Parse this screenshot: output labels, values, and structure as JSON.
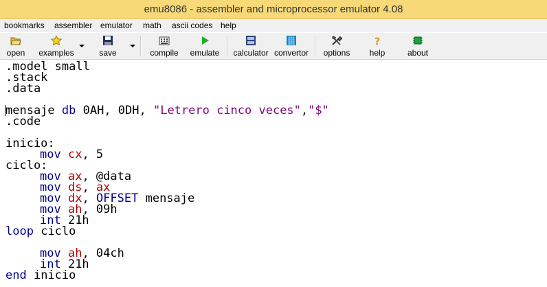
{
  "window": {
    "title": "emu8086 - assembler and microprocessor emulator 4.08"
  },
  "menu": {
    "items": [
      "bookmarks",
      "assembler",
      "emulator",
      "math",
      "ascii codes",
      "help"
    ]
  },
  "toolbar": {
    "open": "open",
    "examples": "examples",
    "save": "save",
    "compile": "compile",
    "emulate": "emulate",
    "calculator": "calculator",
    "convertor": "convertor",
    "options": "options",
    "help": "help",
    "about": "about"
  },
  "icons": {
    "open": "folder-open-icon",
    "examples": "star-icon",
    "save": "floppy-disk-icon",
    "compile": "compile-icon",
    "emulate": "play-icon",
    "calculator": "calculator-icon",
    "convertor": "convertor-icon",
    "options": "tools-icon",
    "help": "question-mark-icon",
    "about": "chip-icon"
  },
  "colors": {
    "titlebar": "#f8d978",
    "keyword": "#00008b",
    "register": "#b00000",
    "string": "#800080"
  },
  "code": {
    "l1": ".model small",
    "l2": ".stack",
    "l3": ".data",
    "l5_a": "mensaje ",
    "l5_b": "db",
    "l5_c": " 0AH, 0DH, ",
    "l5_d": "\"Letrero cinco veces\"",
    "l5_e": ",",
    "l5_f": "\"$\"",
    "l6": ".code",
    "l8": "inicio:",
    "l9_a": "mov",
    "l9_b": "cx",
    "l9_c": ", 5",
    "l10": "ciclo:",
    "l11_a": "mov",
    "l11_b": "ax",
    "l11_c": ", @data",
    "l12_a": "mov",
    "l12_b": "ds",
    "l12_c": ", ",
    "l12_d": "ax",
    "l13_a": "mov",
    "l13_b": "dx",
    "l13_c": ", ",
    "l13_d": "OFFSET",
    "l13_e": " mensaje",
    "l14_a": "mov",
    "l14_b": "ah",
    "l14_c": ", 09h",
    "l15_a": "int",
    "l15_b": " 21h",
    "l16_a": "loop",
    "l16_b": " ciclo",
    "l18_a": "mov",
    "l18_b": "ah",
    "l18_c": ", 04ch",
    "l19_a": "int",
    "l19_b": " 21h",
    "l20_a": "end",
    "l20_b": " inicio"
  }
}
